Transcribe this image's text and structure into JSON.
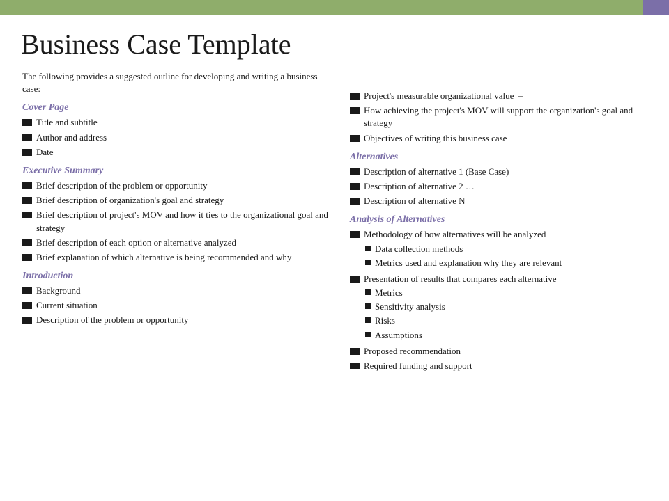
{
  "topBar": {
    "greenColor": "#8fad6b",
    "purpleColor": "#7b6fa8"
  },
  "title": "Business Case Template",
  "introText": "The following provides a suggested outline for developing and writing a business case:",
  "left": {
    "sections": [
      {
        "heading": "Cover Page",
        "items": [
          "Title and subtitle",
          "Author and address",
          "Date"
        ]
      },
      {
        "heading": "Executive Summary",
        "items": [
          "Brief description of the problem or opportunity",
          "Brief description of organization's goal and strategy",
          "Brief description of project's MOV and how it ties to the organizational goal and strategy",
          "Brief description of each option or alternative analyzed",
          "Brief explanation of which alternative is being recommended and why"
        ]
      },
      {
        "heading": "Introduction",
        "items": [
          "Background",
          "Current situation",
          "Description of the problem or opportunity"
        ]
      }
    ]
  },
  "right": {
    "introItems": [
      "Project's measurable organizational value",
      "How achieving the project's MOV will support the organization's goal and strategy",
      "Objectives of writing this business case"
    ],
    "sections": [
      {
        "heading": "Alternatives",
        "items": [
          "Description of alternative 1 (Base Case)",
          "Description of alternative 2 …",
          "Description of alternative N"
        ]
      },
      {
        "heading": "Analysis of Alternatives",
        "items": [
          {
            "text": "Methodology of how alternatives will be analyzed",
            "subItems": [
              "Data collection methods",
              "Metrics used and explanation why they are relevant"
            ]
          },
          {
            "text": "Presentation of results that compares each alternative",
            "subItems": [
              "Metrics",
              "Sensitivity analysis",
              "Risks",
              "Assumptions"
            ]
          },
          {
            "text": "Proposed recommendation",
            "subItems": []
          },
          {
            "text": "Required funding and support",
            "subItems": []
          }
        ]
      }
    ]
  }
}
